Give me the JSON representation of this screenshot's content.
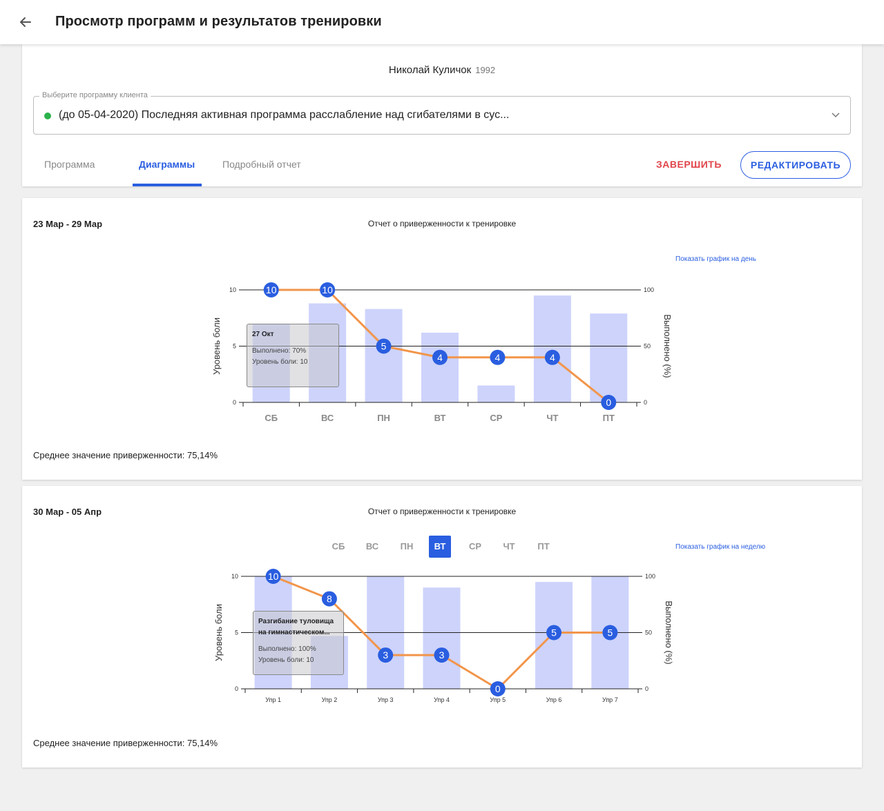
{
  "header": {
    "title": "Просмотр программ и результатов тренировки"
  },
  "client": {
    "name": "Николай Куличок",
    "year": "1992"
  },
  "program_select": {
    "label": "Выберите программу клиента",
    "value": "(до 05-04-2020) Последняя активная программа расслабление над сгибателями в сус..."
  },
  "tabs": [
    {
      "label": "Программа",
      "active": false
    },
    {
      "label": "Диаграммы",
      "active": true
    },
    {
      "label": "Подробный отчет",
      "active": false
    }
  ],
  "actions": {
    "finish_label": "ЗАВЕРШИТЬ",
    "edit_label": "РЕДАКТИРОВАТЬ"
  },
  "colors": {
    "accent": "#2a5ee0",
    "bar": "#cdd3fb",
    "line": "#f2954a",
    "point": "#2a5ee0",
    "danger": "#e0454a",
    "status_dot": "#2bb24c"
  },
  "week1": {
    "period": "23 Мар - 29 Мар",
    "title": "Отчет о приверженности к тренировке",
    "toggle_label": "Показать график на день",
    "average": "Среднее значение приверженности: 75,14%",
    "tooltip": {
      "title": "27 Окт",
      "done": "Выполнено: 70%",
      "pain": "Уровень боли: 10"
    }
  },
  "week2": {
    "period": "30 Мар - 05 Апр",
    "title": "Отчет о приверженности к тренировке",
    "toggle_label": "Показать график на неделю",
    "average": "Среднее значение приверженности: 75,14%",
    "days": [
      "СБ",
      "ВС",
      "ПН",
      "ВТ",
      "СР",
      "ЧТ",
      "ПТ"
    ],
    "selected_day": "ВТ",
    "tooltip": {
      "title_line1": "Разгибание туловища",
      "title_line2": "на гимнастическом...",
      "done": "Выполнено: 100%",
      "pain": "Уровень боли: 10"
    }
  },
  "chart_data": [
    {
      "type": "bar",
      "categories": [
        "СБ",
        "ВС",
        "ПН",
        "ВТ",
        "СР",
        "ЧТ",
        "ПТ"
      ],
      "series": [
        {
          "name": "Выполнено (%)",
          "type": "bar",
          "axis": "right",
          "values": [
            70,
            88,
            83,
            62,
            15,
            95,
            79
          ]
        },
        {
          "name": "Уровень боли",
          "type": "line",
          "axis": "left",
          "values": [
            10,
            10,
            5,
            4,
            4,
            4,
            0
          ]
        }
      ],
      "ylabel_left": "Уровень боли",
      "ylim_left": [
        0,
        10
      ],
      "yticks_left": [
        "0",
        "5",
        "10"
      ],
      "ylabel_right": "Выполнено (%)",
      "ylim_right": [
        0,
        100
      ],
      "yticks_right": [
        "0",
        "50",
        "100"
      ],
      "grid": "horizontal"
    },
    {
      "type": "bar",
      "categories": [
        "Упр 1",
        "Упр 2",
        "Упр 3",
        "Упр 4",
        "Упр 5",
        "Упр 6",
        "Упр 7"
      ],
      "series": [
        {
          "name": "Выполнено (%)",
          "type": "bar",
          "axis": "right",
          "values": [
            100,
            47,
            100,
            90,
            0,
            95,
            100
          ]
        },
        {
          "name": "Уровень боли",
          "type": "line",
          "axis": "left",
          "values": [
            10,
            8,
            3,
            3,
            0,
            5,
            5
          ]
        }
      ],
      "ylabel_left": "Уровень боли",
      "ylim_left": [
        0,
        10
      ],
      "yticks_left": [
        "0",
        "5",
        "10"
      ],
      "ylabel_right": "Выполнено (%)",
      "ylim_right": [
        0,
        100
      ],
      "yticks_right": [
        "0",
        "50",
        "100"
      ],
      "grid": "horizontal"
    }
  ]
}
